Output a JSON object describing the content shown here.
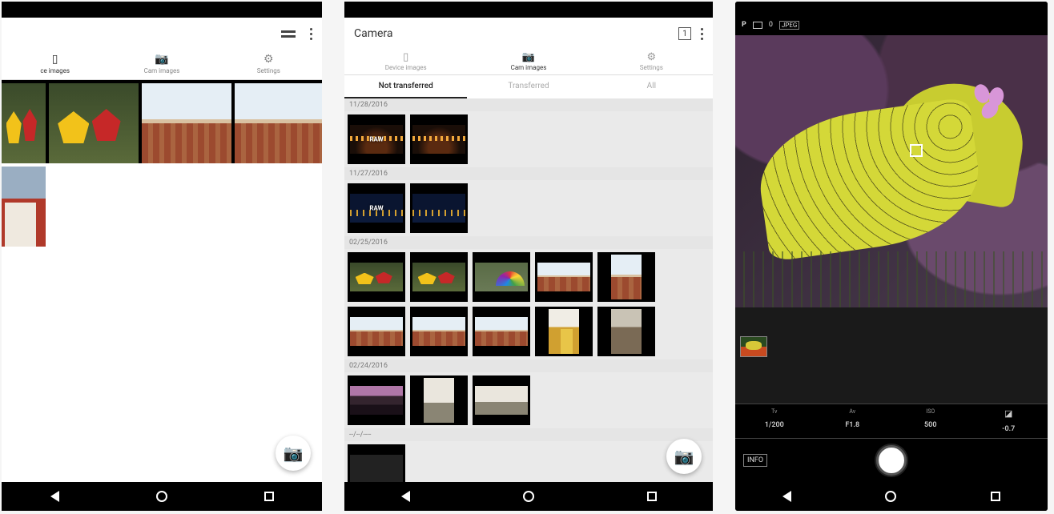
{
  "device1": {
    "tabs": [
      {
        "label": "ce images"
      },
      {
        "label": "Cam images"
      },
      {
        "label": "Settings"
      }
    ]
  },
  "device2": {
    "title": "Camera",
    "badge": "1",
    "tabs": [
      {
        "label": "Device images"
      },
      {
        "label": "Cam images"
      },
      {
        "label": "Settings"
      }
    ],
    "subtabs": [
      {
        "label": "Not transferred"
      },
      {
        "label": "Transferred"
      },
      {
        "label": "All"
      }
    ],
    "groups": [
      {
        "date": "11/28/2016"
      },
      {
        "date": "11/27/2016"
      },
      {
        "date": "02/25/2016"
      },
      {
        "date": "02/24/2016"
      },
      {
        "date": "--/--/----"
      }
    ],
    "raw": "RAW"
  },
  "device3": {
    "top": {
      "mode": "P",
      "count": "0",
      "format": "JPEG"
    },
    "params": {
      "tv_l": "Tv",
      "tv_v": "1/200",
      "av_l": "Av",
      "av_v": "F1.8",
      "iso_l": "ISO",
      "iso_v": "500",
      "ec_l": "",
      "ec_v": "-0.7"
    },
    "info": "INFO"
  }
}
